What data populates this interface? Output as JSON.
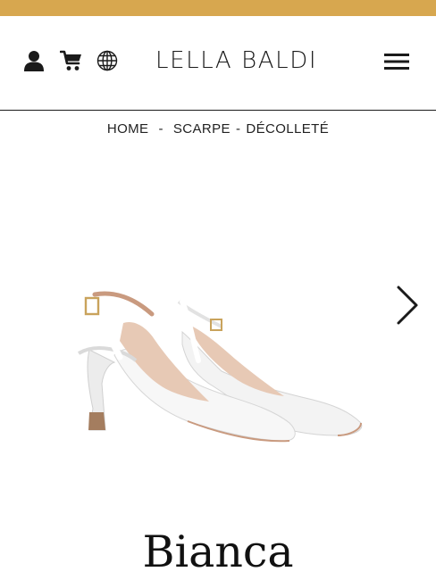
{
  "colors": {
    "accent_bar": "#d7a74f",
    "text": "#111111",
    "strap_tan": "#c99a7f"
  },
  "header": {
    "icons": [
      "user-icon",
      "cart-icon",
      "globe-icon",
      "menu-icon"
    ],
    "brand": "LELLA BALDI"
  },
  "breadcrumb": {
    "items": [
      "HOME",
      "SCARPE",
      "DÉCOLLETÉ"
    ],
    "separator": "-"
  },
  "carousel": {
    "next_icon": "chevron-right-icon"
  },
  "product": {
    "name": "Bianca"
  }
}
